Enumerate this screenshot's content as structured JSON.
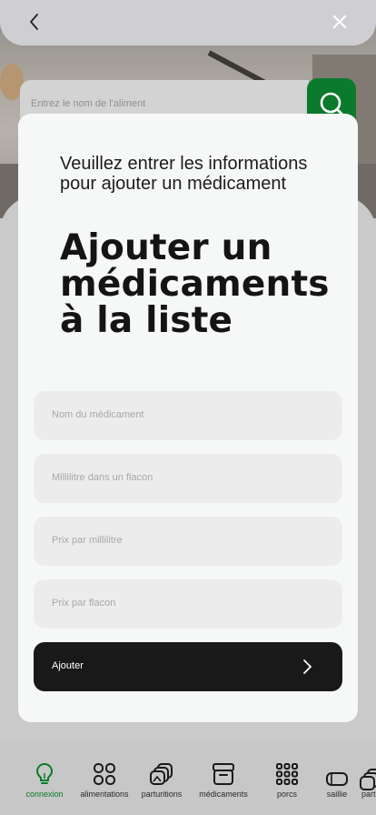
{
  "header": {},
  "search": {
    "placeholder": "Entrez le nom de l'aliment"
  },
  "modal": {
    "subtitle": "Veuillez entrer les informations pour ajouter un médicament",
    "title": "Ajouter un médicaments à la liste",
    "fields": [
      {
        "placeholder": "Nom du médicament"
      },
      {
        "placeholder": "Millilitre dans un flacon"
      },
      {
        "placeholder": "Prix par millilitre"
      },
      {
        "placeholder": "Prix par flacon"
      }
    ],
    "submit_label": "Ajouter"
  },
  "nav": {
    "items": [
      {
        "label": "connexion",
        "icon": "lightbulb-icon",
        "active": true
      },
      {
        "label": "alimentations",
        "icon": "grid-four-icon"
      },
      {
        "label": "parturitions",
        "icon": "layers-icon"
      },
      {
        "label": "médicaments",
        "icon": "archive-box-icon"
      },
      {
        "label": "porcs",
        "icon": "dots-grid-icon"
      },
      {
        "label": "saillie",
        "icon": "capsule-icon"
      },
      {
        "label": "part",
        "icon": "layers-icon"
      }
    ]
  },
  "colors": {
    "accent": "#0c7a2c",
    "button_dark": "#191919",
    "modal_bg": "#f6f8f7",
    "field_bg": "#ececec"
  }
}
